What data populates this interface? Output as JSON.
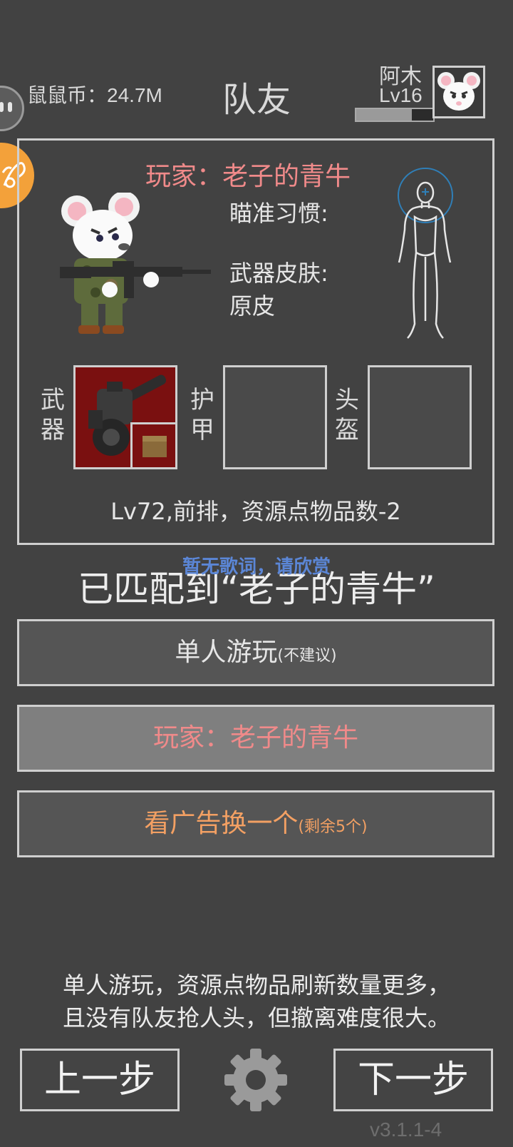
{
  "header": {
    "coins_label": "鼠鼠币：",
    "coins_value": "24.7M",
    "title": "队友",
    "player_name": "阿木",
    "player_level": "Lv16",
    "xp_fraction": 0.72
  },
  "card": {
    "player_line": "玩家：老子的青牛",
    "aim_label": "瞄准习惯:",
    "skin_label": "武器皮肤:",
    "skin_value": "原皮",
    "slots": {
      "weapon": "武器",
      "armor": "护甲",
      "helmet": "头盔"
    },
    "stats": "Lv72,前排，资源点物品数-2"
  },
  "lyric_overlay": "暂无歌词，请欣赏",
  "matched_text": "已匹配到“老子的青牛”",
  "buttons": {
    "solo_main": "单人游玩",
    "solo_note": "(不建议)",
    "teammate": "玩家：老子的青牛",
    "ad_main": "看广告换一个",
    "ad_note": "(剩余5个)"
  },
  "hint_line1": "单人游玩，资源点物品刷新数量更多，",
  "hint_line2": "且没有队友抢人头，但撤离难度很大。",
  "nav": {
    "prev": "上一步",
    "next": "下一步"
  },
  "version": "v3.1.1-4",
  "colors": {
    "background": "#424242",
    "highlight_pink": "#f08a8a",
    "ad_orange": "#f3a063",
    "weapon_slot": "#7a1010",
    "lyric_blue": "#5b86d6"
  }
}
